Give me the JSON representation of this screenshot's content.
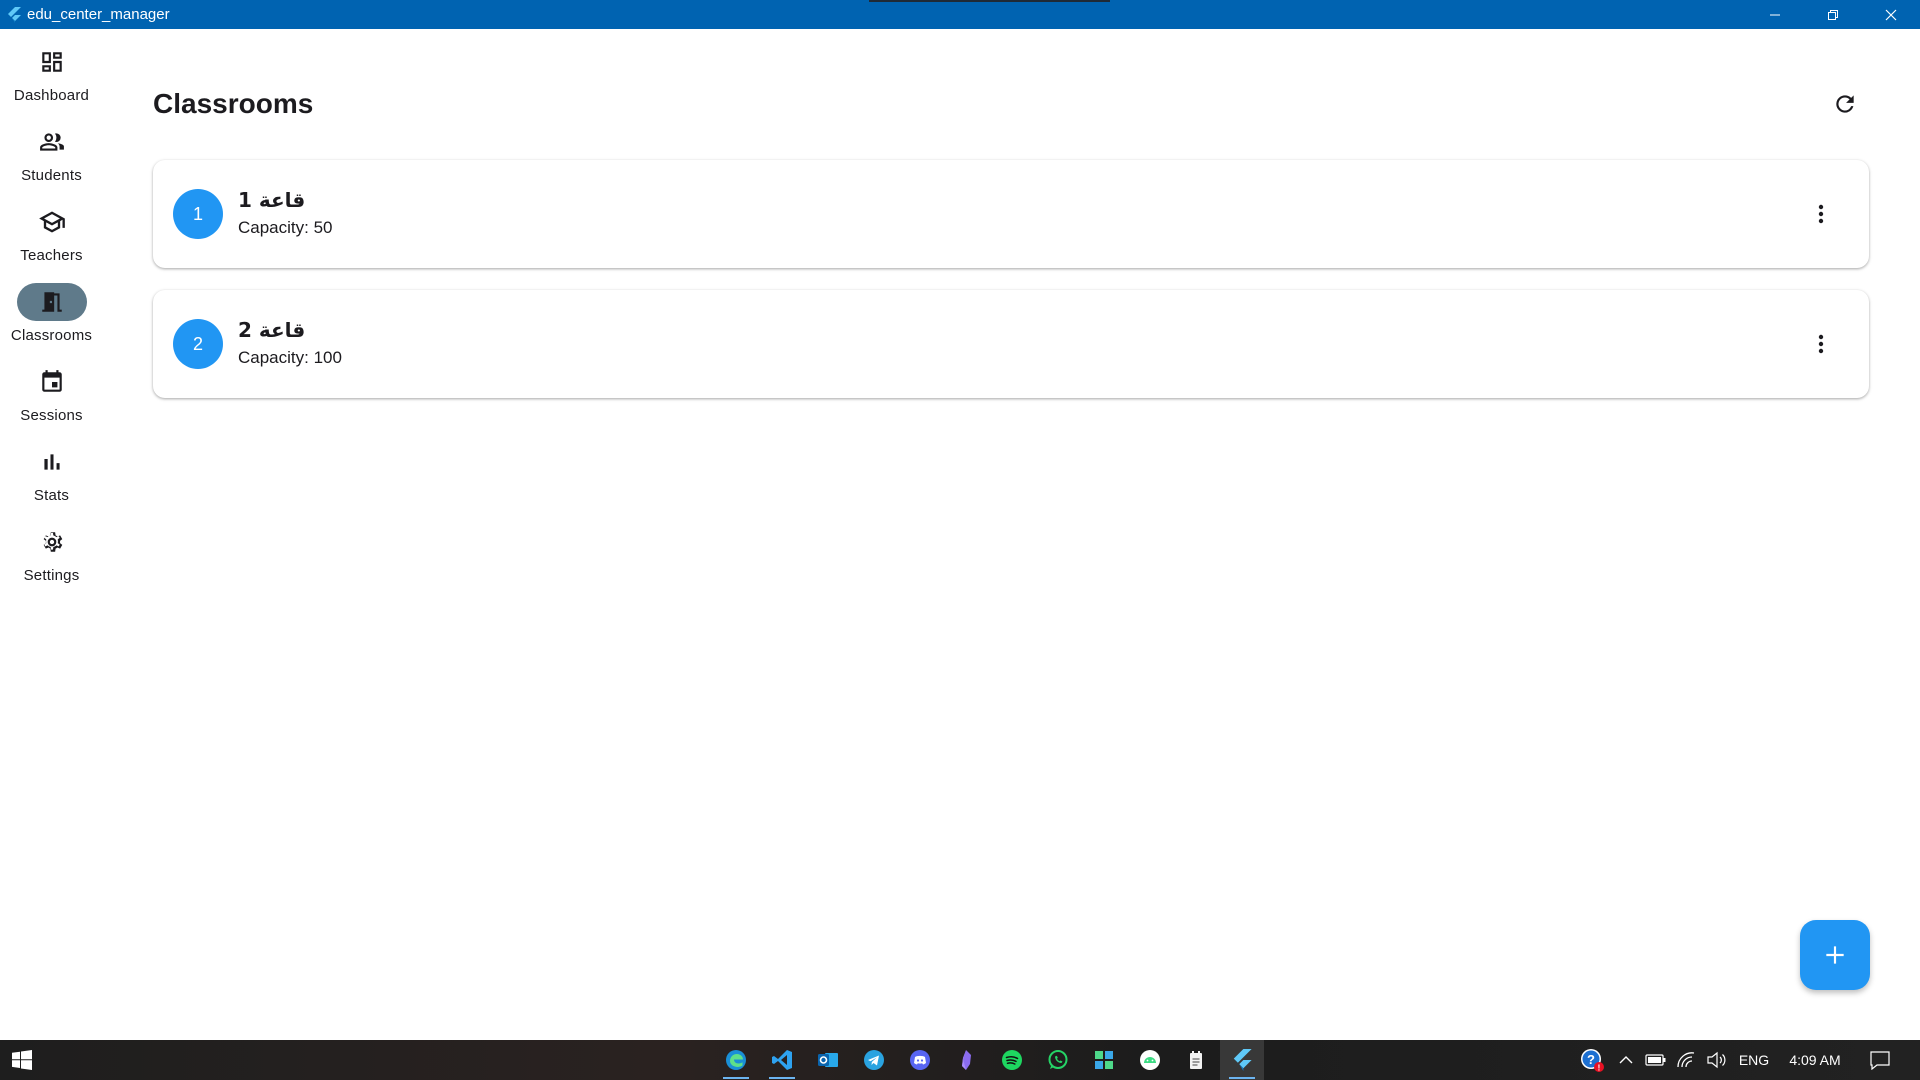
{
  "window": {
    "title": "edu_center_manager"
  },
  "nav": {
    "items": [
      {
        "label": "Dashboard",
        "icon": "dashboard-icon",
        "active": false
      },
      {
        "label": "Students",
        "icon": "people-icon",
        "active": false
      },
      {
        "label": "Teachers",
        "icon": "school-icon",
        "active": false
      },
      {
        "label": "Classrooms",
        "icon": "door-icon",
        "active": true
      },
      {
        "label": "Sessions",
        "icon": "calendar-icon",
        "active": false
      },
      {
        "label": "Stats",
        "icon": "bar-chart-icon",
        "active": false
      },
      {
        "label": "Settings",
        "icon": "gear-icon",
        "active": false
      }
    ]
  },
  "page": {
    "title": "Classrooms"
  },
  "classrooms": [
    {
      "number": "1",
      "name": "قاعة 1",
      "capacity": "Capacity: 50"
    },
    {
      "number": "2",
      "name": "قاعة 2",
      "capacity": "Capacity: 100"
    }
  ],
  "taskbar": {
    "apps": [
      "edge-icon",
      "vscode-icon",
      "outlook-icon",
      "telegram-icon",
      "discord-icon",
      "obsidian-icon",
      "spotify-icon",
      "whatsapp-icon",
      "xbox-icon",
      "android-studio-icon",
      "notepad-icon",
      "flutter-icon"
    ],
    "language": "ENG",
    "time": "4:09 AM"
  },
  "colors": {
    "titlebar": "#0063b1",
    "accent": "#2196f3",
    "nav_active": "#5f7a8a"
  }
}
